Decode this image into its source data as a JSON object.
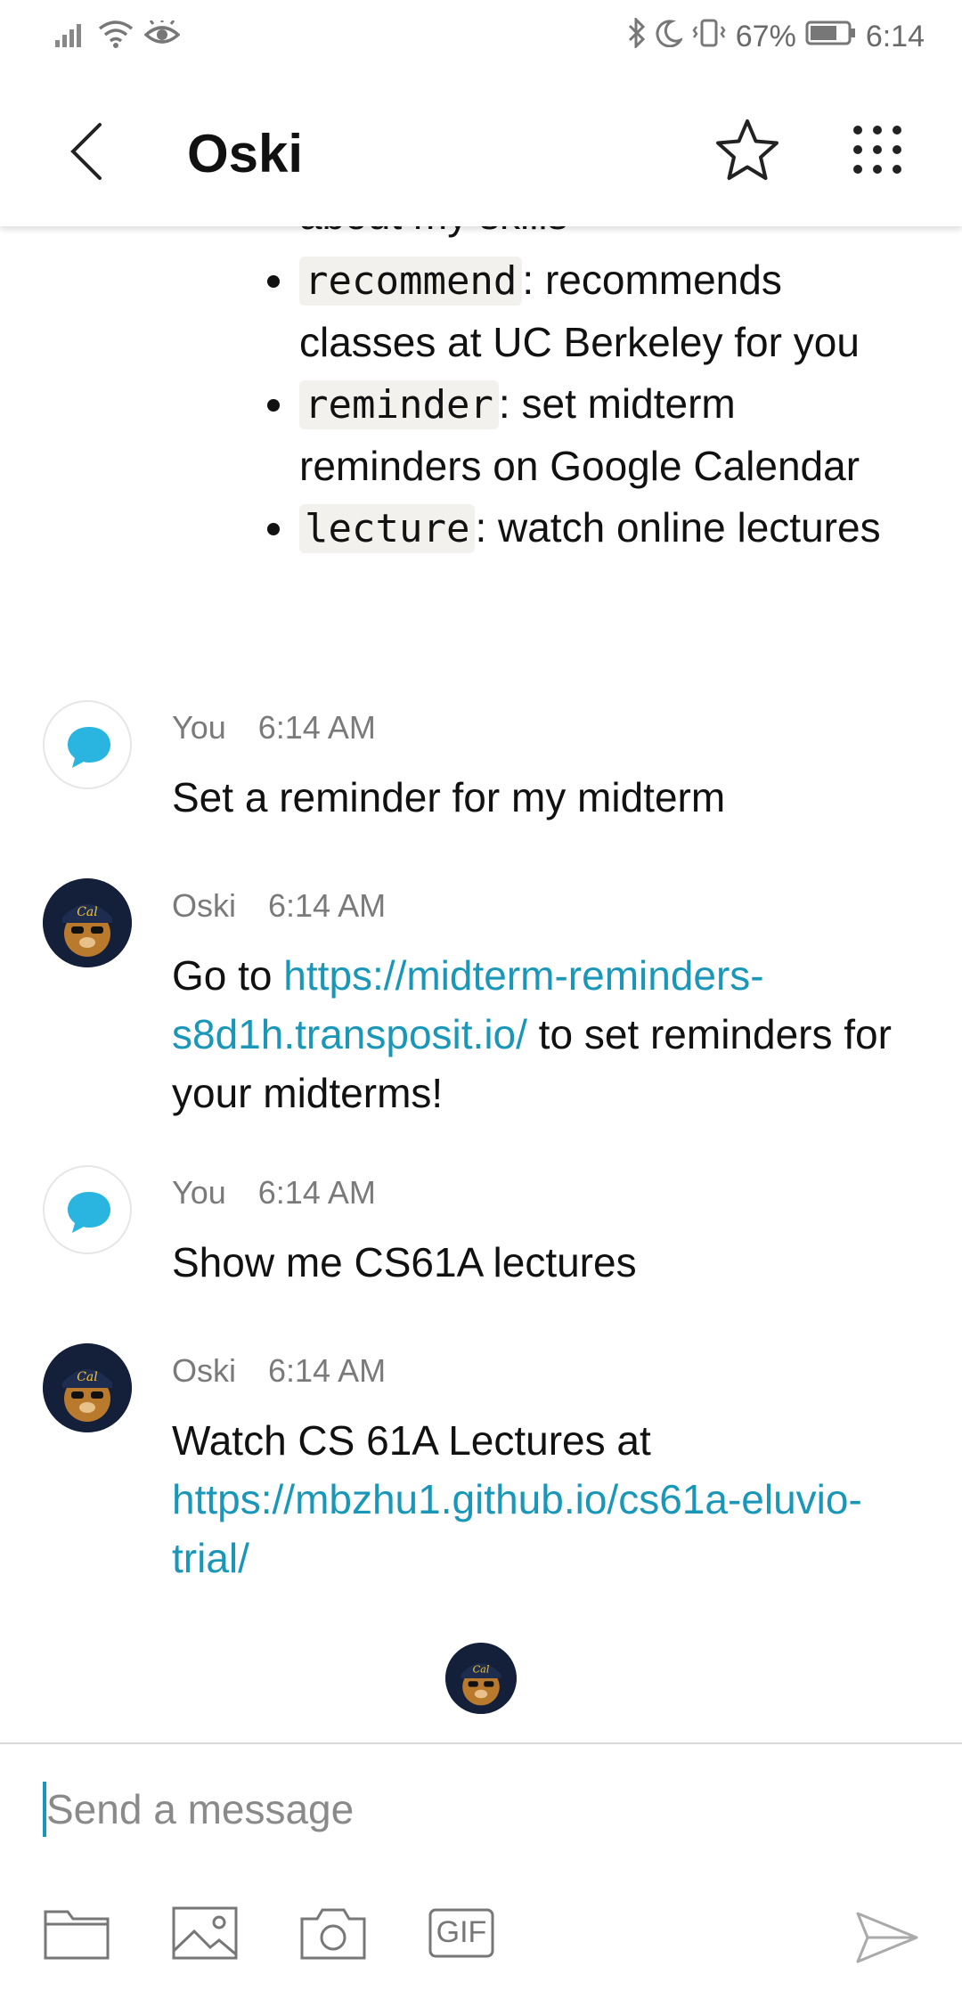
{
  "status_bar": {
    "battery_percent": "67%",
    "time": "6:14",
    "icons": [
      "signal-icon",
      "wifi-icon",
      "eye-icon",
      "bluetooth-icon",
      "moon-icon",
      "vibrate-icon",
      "battery-icon"
    ]
  },
  "header": {
    "title": "Oski",
    "back_icon": "chevron-left-icon",
    "star_icon": "star-icon",
    "menu_icon": "grid-menu-icon"
  },
  "skills_partial": {
    "cut_off_line": "about my skills",
    "items": [
      {
        "cmd": "recommend",
        "desc": ": recommends classes at UC Berkeley for you"
      },
      {
        "cmd": "reminder",
        "desc": ": set midterm reminders on Google Calendar"
      },
      {
        "cmd": "lecture",
        "desc": ": watch online lectures"
      }
    ]
  },
  "messages": [
    {
      "sender": "You",
      "time": "6:14 AM",
      "text": "Set a reminder for my midterm"
    },
    {
      "sender": "Oski",
      "time": "6:14 AM",
      "text_before": "Go to ",
      "link": "https://midterm-reminders-s8d1h.transposit.io/",
      "text_after": " to set reminders for your midterms!"
    },
    {
      "sender": "You",
      "time": "6:14 AM",
      "text": "Show me CS61A lectures"
    },
    {
      "sender": "Oski",
      "time": "6:14 AM",
      "text_before": "Watch CS 61A Lectures at ",
      "link": "https://mbzhu1.github.io/cs61a-eluvio-trial/"
    }
  ],
  "composer": {
    "placeholder": "Send a message",
    "tools": [
      "folder-icon",
      "image-icon",
      "camera-icon",
      "gif-icon"
    ],
    "gif_label": "GIF",
    "send_icon": "send-icon"
  },
  "colors": {
    "link": "#1a97b8",
    "accent": "#2ab5e0",
    "bot_avatar_bg": "#14203a"
  }
}
